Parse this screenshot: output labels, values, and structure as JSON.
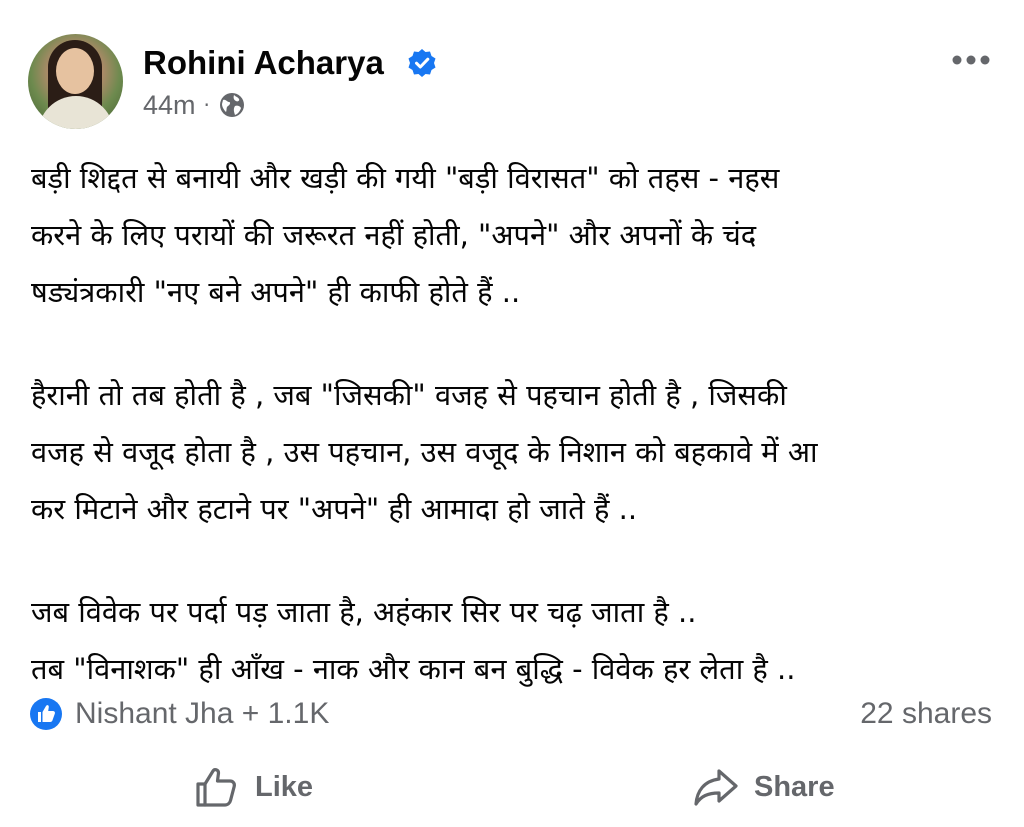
{
  "post": {
    "author": "Rohini Acharya",
    "time": "44m",
    "separator": "·",
    "verified_icon": "verified-badge-icon",
    "privacy_icon": "globe-icon",
    "more_icon": "more-options-icon",
    "paragraphs": [
      [
        "बड़ी शिद्दत से बनायी और खड़ी की गयी \"बड़ी विरासत\" को तहस - नहस",
        "करने के लिए परायों की जरूरत नहीं होती, \"अपने\" और अपनों के चंद",
        "षड्यंत्रकारी \"नए बने अपने\" ही काफी होते हैं .."
      ],
      [
        "हैरानी तो तब होती है , जब \"जिसकी\" वजह से पहचान होती है , जिसकी",
        "वजह से वजूद होता है , उस पहचान, उस वजूद के निशान को बहकावे में आ",
        "कर मिटाने और हटाने पर \"अपने\" ही आमादा हो जाते हैं .."
      ],
      [
        "जब विवेक पर पर्दा पड़ जाता है, अहंकार सिर पर चढ़ जाता है ..",
        "तब \"विनाशक\" ही आँख - नाक और कान बन बुद्धि - विवेक हर लेता है .."
      ]
    ]
  },
  "engagement": {
    "reactions_text": "Nishant Jha + 1.1K",
    "reaction_icon": "like-reaction-icon",
    "shares_text": "22 shares"
  },
  "actions": {
    "like_label": "Like",
    "share_label": "Share"
  },
  "colors": {
    "text": "#050505",
    "secondary": "#65676b",
    "accent": "#1877f2"
  }
}
